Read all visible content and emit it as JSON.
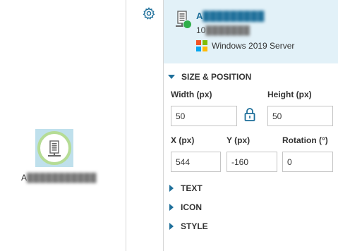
{
  "canvas": {
    "node": {
      "label_prefix": "A",
      "label_obscured": "███████████",
      "status": "online",
      "icon": "server-icon",
      "ring_color": "#b5dc95",
      "selection_color": "#bfe0ec"
    }
  },
  "rail": {
    "settings_icon": "gear-icon"
  },
  "panel": {
    "header": {
      "name_prefix": "A",
      "name_obscured": "█████████",
      "ip_prefix": "10",
      "ip_obscured": "███████",
      "os": "Windows 2019 Server",
      "os_icon": "windows-logo-icon",
      "status_color": "#2fae4a",
      "background": "#e2f1f8"
    },
    "size_position": {
      "title": "SIZE & POSITION",
      "width_label": "Width (px)",
      "height_label": "Height (px)",
      "width_value": "50",
      "height_value": "50",
      "x_label": "X (px)",
      "y_label": "Y (px)",
      "rotation_label": "Rotation (°)",
      "x_value": "544",
      "y_value": "-160",
      "rotation_value": "0",
      "lock_icon": "lock-icon"
    },
    "sections": {
      "text": "TEXT",
      "icon": "ICON",
      "style": "STYLE"
    },
    "accent": "#1e6f9a"
  }
}
